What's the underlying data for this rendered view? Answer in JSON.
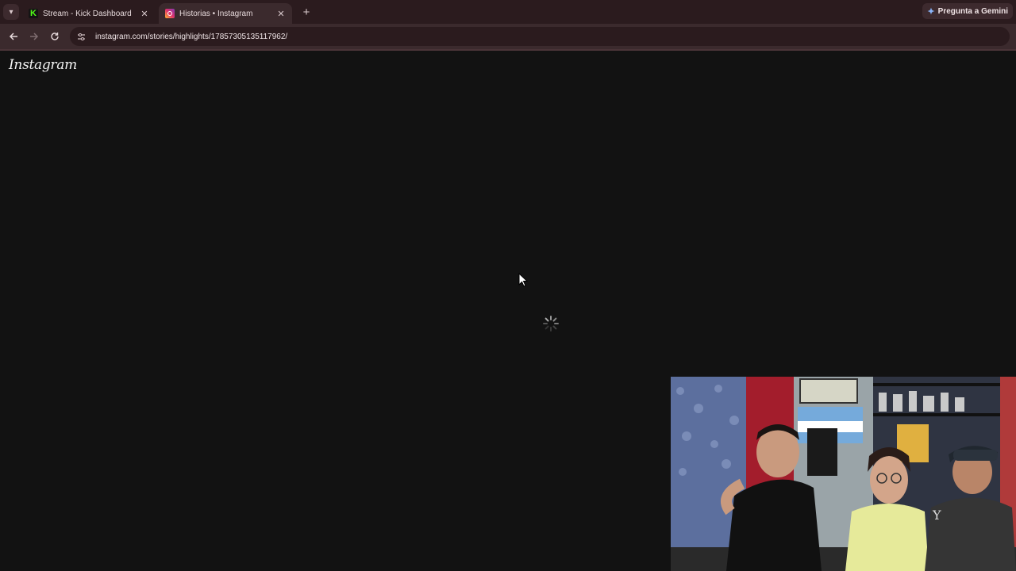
{
  "browser": {
    "tabs": [
      {
        "title": "Stream - Kick Dashboard",
        "icon": "kick-icon",
        "active": false
      },
      {
        "title": "Historias • Instagram",
        "icon": "instagram-icon",
        "active": true
      }
    ],
    "gemini_label": "Pregunta a Gemini",
    "url": "instagram.com/stories/highlights/17857305135117962/"
  },
  "page": {
    "logo_text": "Instagram",
    "state": "loading"
  },
  "overlay": {
    "type": "webcam-feed",
    "people_count": 3
  },
  "colors": {
    "chrome_dark": "#2b1b1e",
    "chrome_toolbar": "#3b2a2d",
    "page_bg": "#121212",
    "kick_green": "#53fc18"
  }
}
